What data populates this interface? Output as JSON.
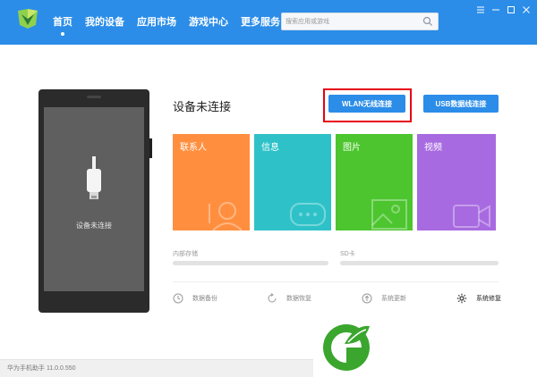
{
  "window": {
    "nav": [
      {
        "label": "首页",
        "active": true
      },
      {
        "label": "我的设备",
        "active": false
      },
      {
        "label": "应用市场",
        "active": false
      },
      {
        "label": "游戏中心",
        "active": false
      },
      {
        "label": "更多服务",
        "active": false
      }
    ],
    "search_placeholder": "搜索应用或游戏",
    "controls": [
      "menu-icon",
      "minimize-icon",
      "maximize-icon",
      "close-icon"
    ]
  },
  "phone": {
    "status_text": "设备未连接"
  },
  "device": {
    "title": "设备未连接",
    "wlan_button": "WLAN无线连接",
    "usb_button": "USB数据线连接"
  },
  "tiles": [
    {
      "label": "联系人",
      "color": "#ff8f3f",
      "icon": "contact-icon"
    },
    {
      "label": "信息",
      "color": "#2ec2c8",
      "icon": "message-icon"
    },
    {
      "label": "图片",
      "color": "#4cc52e",
      "icon": "picture-icon"
    },
    {
      "label": "视频",
      "color": "#a86ae0",
      "icon": "video-icon"
    }
  ],
  "storage": {
    "internal_label": "内部存储",
    "sd_label": "SD卡"
  },
  "actions": [
    {
      "label": "数据备份",
      "icon": "backup-icon"
    },
    {
      "label": "数据恢复",
      "icon": "restore-icon"
    },
    {
      "label": "系统更新",
      "icon": "update-icon"
    },
    {
      "label": "系统修复",
      "icon": "gear-icon"
    }
  ],
  "status_bar": "华为手机助手 11.0.0.550",
  "colors": {
    "accent": "#2b8de8",
    "highlight": "#e60012"
  }
}
